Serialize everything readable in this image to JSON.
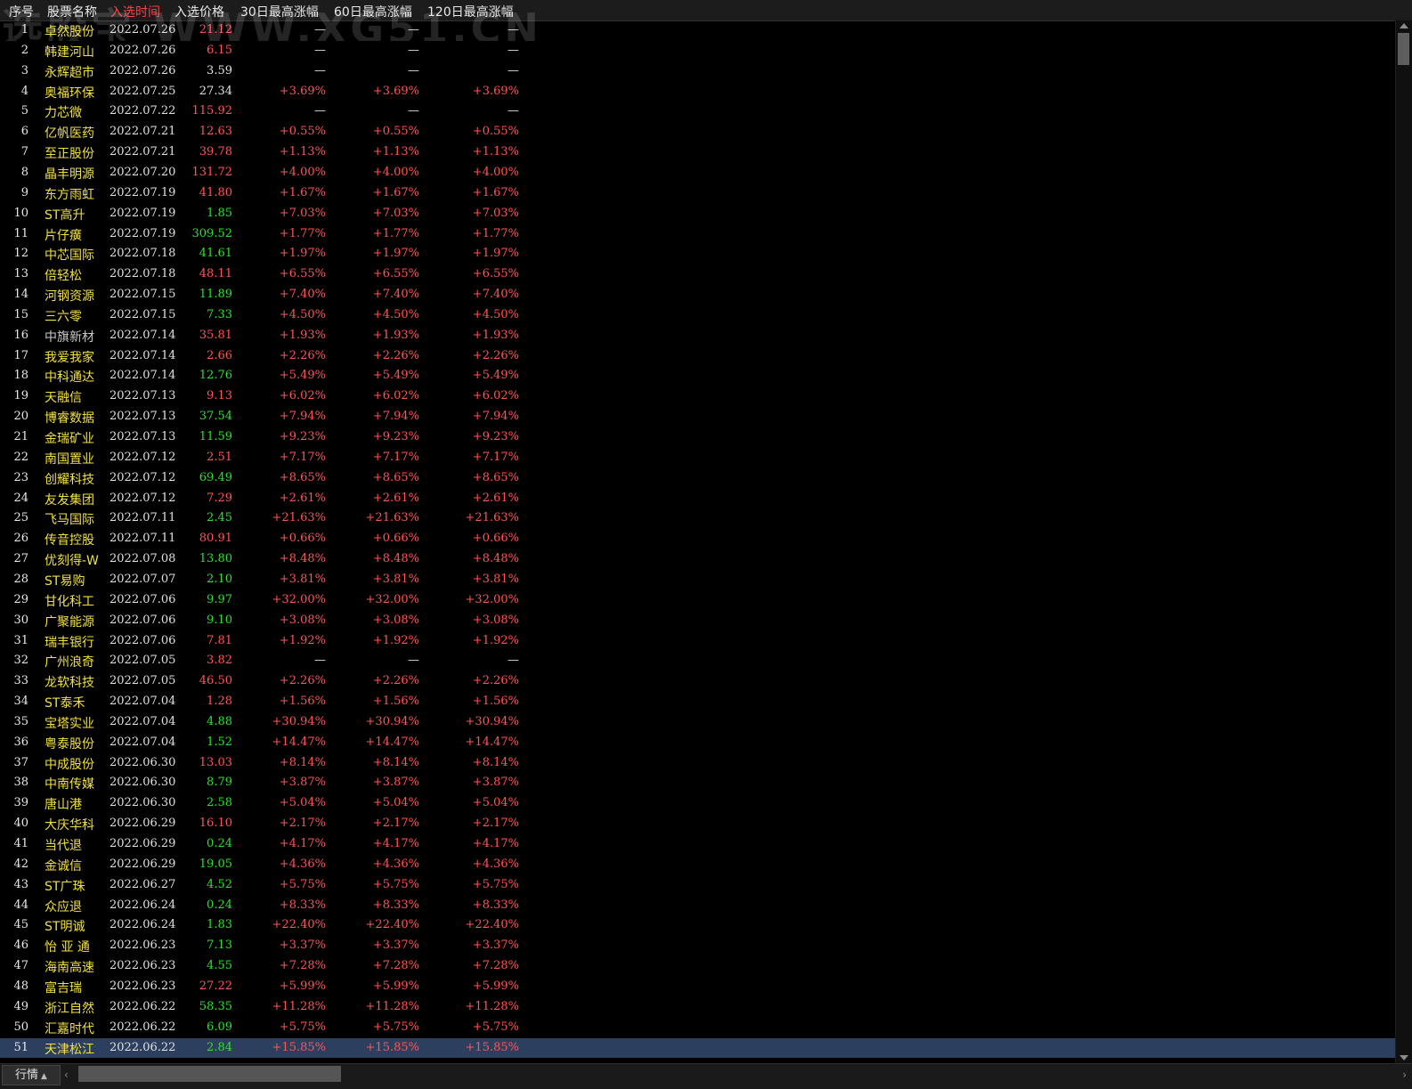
{
  "header": {
    "columns": [
      "序号",
      "股票名称",
      "入选时间",
      "入选价格",
      "30日最高涨幅",
      "60日最高涨幅",
      "120日最高涨幅"
    ],
    "active_column": "入选时间"
  },
  "watermark": "选股宝 WWW.XG51.CN",
  "colors": {
    "up": "#ff5555",
    "down": "#2ee02e",
    "neutral": "#e0e0e0",
    "name": "#f0e040",
    "selected": "#2d3f5f"
  },
  "rows": [
    {
      "idx": "1",
      "name": "卓然股份",
      "date": "2022.07.26",
      "price": "21.12",
      "pc": "r",
      "g30": "—",
      "g60": "—",
      "g120": "—"
    },
    {
      "idx": "2",
      "name": "韩建河山",
      "date": "2022.07.26",
      "price": "6.15",
      "pc": "r",
      "g30": "—",
      "g60": "—",
      "g120": "—"
    },
    {
      "idx": "3",
      "name": "永辉超市",
      "date": "2022.07.26",
      "price": "3.59",
      "pc": "w",
      "g30": "—",
      "g60": "—",
      "g120": "—"
    },
    {
      "idx": "4",
      "name": "奥福环保",
      "date": "2022.07.25",
      "price": "27.34",
      "pc": "w",
      "g30": "+3.69%",
      "g60": "+3.69%",
      "g120": "+3.69%"
    },
    {
      "idx": "5",
      "name": "力芯微",
      "date": "2022.07.22",
      "price": "115.92",
      "pc": "r",
      "g30": "—",
      "g60": "—",
      "g120": "—"
    },
    {
      "idx": "6",
      "name": "亿帆医药",
      "date": "2022.07.21",
      "price": "12.63",
      "pc": "r",
      "g30": "+0.55%",
      "g60": "+0.55%",
      "g120": "+0.55%"
    },
    {
      "idx": "7",
      "name": "至正股份",
      "date": "2022.07.21",
      "price": "39.78",
      "pc": "r",
      "g30": "+1.13%",
      "g60": "+1.13%",
      "g120": "+1.13%"
    },
    {
      "idx": "8",
      "name": "晶丰明源",
      "date": "2022.07.20",
      "price": "131.72",
      "pc": "r",
      "g30": "+4.00%",
      "g60": "+4.00%",
      "g120": "+4.00%"
    },
    {
      "idx": "9",
      "name": "东方雨虹",
      "date": "2022.07.19",
      "price": "41.80",
      "pc": "r",
      "g30": "+1.67%",
      "g60": "+1.67%",
      "g120": "+1.67%"
    },
    {
      "idx": "10",
      "name": "ST高升",
      "date": "2022.07.19",
      "price": "1.85",
      "pc": "g",
      "g30": "+7.03%",
      "g60": "+7.03%",
      "g120": "+7.03%"
    },
    {
      "idx": "11",
      "name": "片仔癀",
      "date": "2022.07.19",
      "price": "309.52",
      "pc": "g",
      "g30": "+1.77%",
      "g60": "+1.77%",
      "g120": "+1.77%"
    },
    {
      "idx": "12",
      "name": "中芯国际",
      "date": "2022.07.18",
      "price": "41.61",
      "pc": "g",
      "g30": "+1.97%",
      "g60": "+1.97%",
      "g120": "+1.97%"
    },
    {
      "idx": "13",
      "name": "倍轻松",
      "date": "2022.07.18",
      "price": "48.11",
      "pc": "r",
      "g30": "+6.55%",
      "g60": "+6.55%",
      "g120": "+6.55%"
    },
    {
      "idx": "14",
      "name": "河钢资源",
      "date": "2022.07.15",
      "price": "11.89",
      "pc": "g",
      "g30": "+7.40%",
      "g60": "+7.40%",
      "g120": "+7.40%"
    },
    {
      "idx": "15",
      "name": "三六零",
      "date": "2022.07.15",
      "price": "7.33",
      "pc": "g",
      "g30": "+4.50%",
      "g60": "+4.50%",
      "g120": "+4.50%"
    },
    {
      "idx": "16",
      "name": "中旗新材",
      "date": "2022.07.14",
      "price": "35.81",
      "pc": "r",
      "g30": "+1.93%",
      "g60": "+1.93%",
      "g120": "+1.93%",
      "gray": true
    },
    {
      "idx": "17",
      "name": "我爱我家",
      "date": "2022.07.14",
      "price": "2.66",
      "pc": "r",
      "g30": "+2.26%",
      "g60": "+2.26%",
      "g120": "+2.26%"
    },
    {
      "idx": "18",
      "name": "中科通达",
      "date": "2022.07.14",
      "price": "12.76",
      "pc": "g",
      "g30": "+5.49%",
      "g60": "+5.49%",
      "g120": "+5.49%"
    },
    {
      "idx": "19",
      "name": "天融信",
      "date": "2022.07.13",
      "price": "9.13",
      "pc": "r",
      "g30": "+6.02%",
      "g60": "+6.02%",
      "g120": "+6.02%"
    },
    {
      "idx": "20",
      "name": "博睿数据",
      "date": "2022.07.13",
      "price": "37.54",
      "pc": "g",
      "g30": "+7.94%",
      "g60": "+7.94%",
      "g120": "+7.94%"
    },
    {
      "idx": "21",
      "name": "金瑞矿业",
      "date": "2022.07.13",
      "price": "11.59",
      "pc": "g",
      "g30": "+9.23%",
      "g60": "+9.23%",
      "g120": "+9.23%"
    },
    {
      "idx": "22",
      "name": "南国置业",
      "date": "2022.07.12",
      "price": "2.51",
      "pc": "r",
      "g30": "+7.17%",
      "g60": "+7.17%",
      "g120": "+7.17%"
    },
    {
      "idx": "23",
      "name": "创耀科技",
      "date": "2022.07.12",
      "price": "69.49",
      "pc": "g",
      "g30": "+8.65%",
      "g60": "+8.65%",
      "g120": "+8.65%"
    },
    {
      "idx": "24",
      "name": "友发集团",
      "date": "2022.07.12",
      "price": "7.29",
      "pc": "r",
      "g30": "+2.61%",
      "g60": "+2.61%",
      "g120": "+2.61%"
    },
    {
      "idx": "25",
      "name": "飞马国际",
      "date": "2022.07.11",
      "price": "2.45",
      "pc": "g",
      "g30": "+21.63%",
      "g60": "+21.63%",
      "g120": "+21.63%"
    },
    {
      "idx": "26",
      "name": "传音控股",
      "date": "2022.07.11",
      "price": "80.91",
      "pc": "r",
      "g30": "+0.66%",
      "g60": "+0.66%",
      "g120": "+0.66%"
    },
    {
      "idx": "27",
      "name": "优刻得-W",
      "date": "2022.07.08",
      "price": "13.80",
      "pc": "g",
      "g30": "+8.48%",
      "g60": "+8.48%",
      "g120": "+8.48%"
    },
    {
      "idx": "28",
      "name": "ST易购",
      "date": "2022.07.07",
      "price": "2.10",
      "pc": "g",
      "g30": "+3.81%",
      "g60": "+3.81%",
      "g120": "+3.81%"
    },
    {
      "idx": "29",
      "name": "甘化科工",
      "date": "2022.07.06",
      "price": "9.97",
      "pc": "g",
      "g30": "+32.00%",
      "g60": "+32.00%",
      "g120": "+32.00%"
    },
    {
      "idx": "30",
      "name": "广聚能源",
      "date": "2022.07.06",
      "price": "9.10",
      "pc": "g",
      "g30": "+3.08%",
      "g60": "+3.08%",
      "g120": "+3.08%"
    },
    {
      "idx": "31",
      "name": "瑞丰银行",
      "date": "2022.07.06",
      "price": "7.81",
      "pc": "r",
      "g30": "+1.92%",
      "g60": "+1.92%",
      "g120": "+1.92%"
    },
    {
      "idx": "32",
      "name": "广州浪奇",
      "date": "2022.07.05",
      "price": "3.82",
      "pc": "r",
      "g30": "—",
      "g60": "—",
      "g120": "—"
    },
    {
      "idx": "33",
      "name": "龙软科技",
      "date": "2022.07.05",
      "price": "46.50",
      "pc": "r",
      "g30": "+2.26%",
      "g60": "+2.26%",
      "g120": "+2.26%"
    },
    {
      "idx": "34",
      "name": "ST泰禾",
      "date": "2022.07.04",
      "price": "1.28",
      "pc": "r",
      "g30": "+1.56%",
      "g60": "+1.56%",
      "g120": "+1.56%"
    },
    {
      "idx": "35",
      "name": "宝塔实业",
      "date": "2022.07.04",
      "price": "4.88",
      "pc": "g",
      "g30": "+30.94%",
      "g60": "+30.94%",
      "g120": "+30.94%"
    },
    {
      "idx": "36",
      "name": "粤泰股份",
      "date": "2022.07.04",
      "price": "1.52",
      "pc": "g",
      "g30": "+14.47%",
      "g60": "+14.47%",
      "g120": "+14.47%"
    },
    {
      "idx": "37",
      "name": "中成股份",
      "date": "2022.06.30",
      "price": "13.03",
      "pc": "r",
      "g30": "+8.14%",
      "g60": "+8.14%",
      "g120": "+8.14%"
    },
    {
      "idx": "38",
      "name": "中南传媒",
      "date": "2022.06.30",
      "price": "8.79",
      "pc": "g",
      "g30": "+3.87%",
      "g60": "+3.87%",
      "g120": "+3.87%"
    },
    {
      "idx": "39",
      "name": "唐山港",
      "date": "2022.06.30",
      "price": "2.58",
      "pc": "g",
      "g30": "+5.04%",
      "g60": "+5.04%",
      "g120": "+5.04%"
    },
    {
      "idx": "40",
      "name": "大庆华科",
      "date": "2022.06.29",
      "price": "16.10",
      "pc": "r",
      "g30": "+2.17%",
      "g60": "+2.17%",
      "g120": "+2.17%"
    },
    {
      "idx": "41",
      "name": "当代退",
      "date": "2022.06.29",
      "price": "0.24",
      "pc": "g",
      "g30": "+4.17%",
      "g60": "+4.17%",
      "g120": "+4.17%"
    },
    {
      "idx": "42",
      "name": "金诚信",
      "date": "2022.06.29",
      "price": "19.05",
      "pc": "g",
      "g30": "+4.36%",
      "g60": "+4.36%",
      "g120": "+4.36%"
    },
    {
      "idx": "43",
      "name": "ST广珠",
      "date": "2022.06.27",
      "price": "4.52",
      "pc": "g",
      "g30": "+5.75%",
      "g60": "+5.75%",
      "g120": "+5.75%"
    },
    {
      "idx": "44",
      "name": "众应退",
      "date": "2022.06.24",
      "price": "0.24",
      "pc": "g",
      "g30": "+8.33%",
      "g60": "+8.33%",
      "g120": "+8.33%"
    },
    {
      "idx": "45",
      "name": "ST明诚",
      "date": "2022.06.24",
      "price": "1.83",
      "pc": "g",
      "g30": "+22.40%",
      "g60": "+22.40%",
      "g120": "+22.40%"
    },
    {
      "idx": "46",
      "name": "怡 亚 通",
      "date": "2022.06.23",
      "price": "7.13",
      "pc": "g",
      "g30": "+3.37%",
      "g60": "+3.37%",
      "g120": "+3.37%"
    },
    {
      "idx": "47",
      "name": "海南高速",
      "date": "2022.06.23",
      "price": "4.55",
      "pc": "g",
      "g30": "+7.28%",
      "g60": "+7.28%",
      "g120": "+7.28%"
    },
    {
      "idx": "48",
      "name": "富吉瑞",
      "date": "2022.06.23",
      "price": "27.22",
      "pc": "r",
      "g30": "+5.99%",
      "g60": "+5.99%",
      "g120": "+5.99%"
    },
    {
      "idx": "49",
      "name": "浙江自然",
      "date": "2022.06.22",
      "price": "58.35",
      "pc": "g",
      "g30": "+11.28%",
      "g60": "+11.28%",
      "g120": "+11.28%"
    },
    {
      "idx": "50",
      "name": "汇嘉时代",
      "date": "2022.06.22",
      "price": "6.09",
      "pc": "g",
      "g30": "+5.75%",
      "g60": "+5.75%",
      "g120": "+5.75%"
    },
    {
      "idx": "51",
      "name": "天津松江",
      "date": "2022.06.22",
      "price": "2.84",
      "pc": "g",
      "g30": "+15.85%",
      "g60": "+15.85%",
      "g120": "+15.85%",
      "selected": true
    }
  ],
  "bottom": {
    "tab_label": "行情",
    "tab_caret": "▲",
    "hscroll_left": "‹",
    "hscroll_right": "›"
  },
  "scrollbar": {
    "up": "▲",
    "down": "▼"
  }
}
